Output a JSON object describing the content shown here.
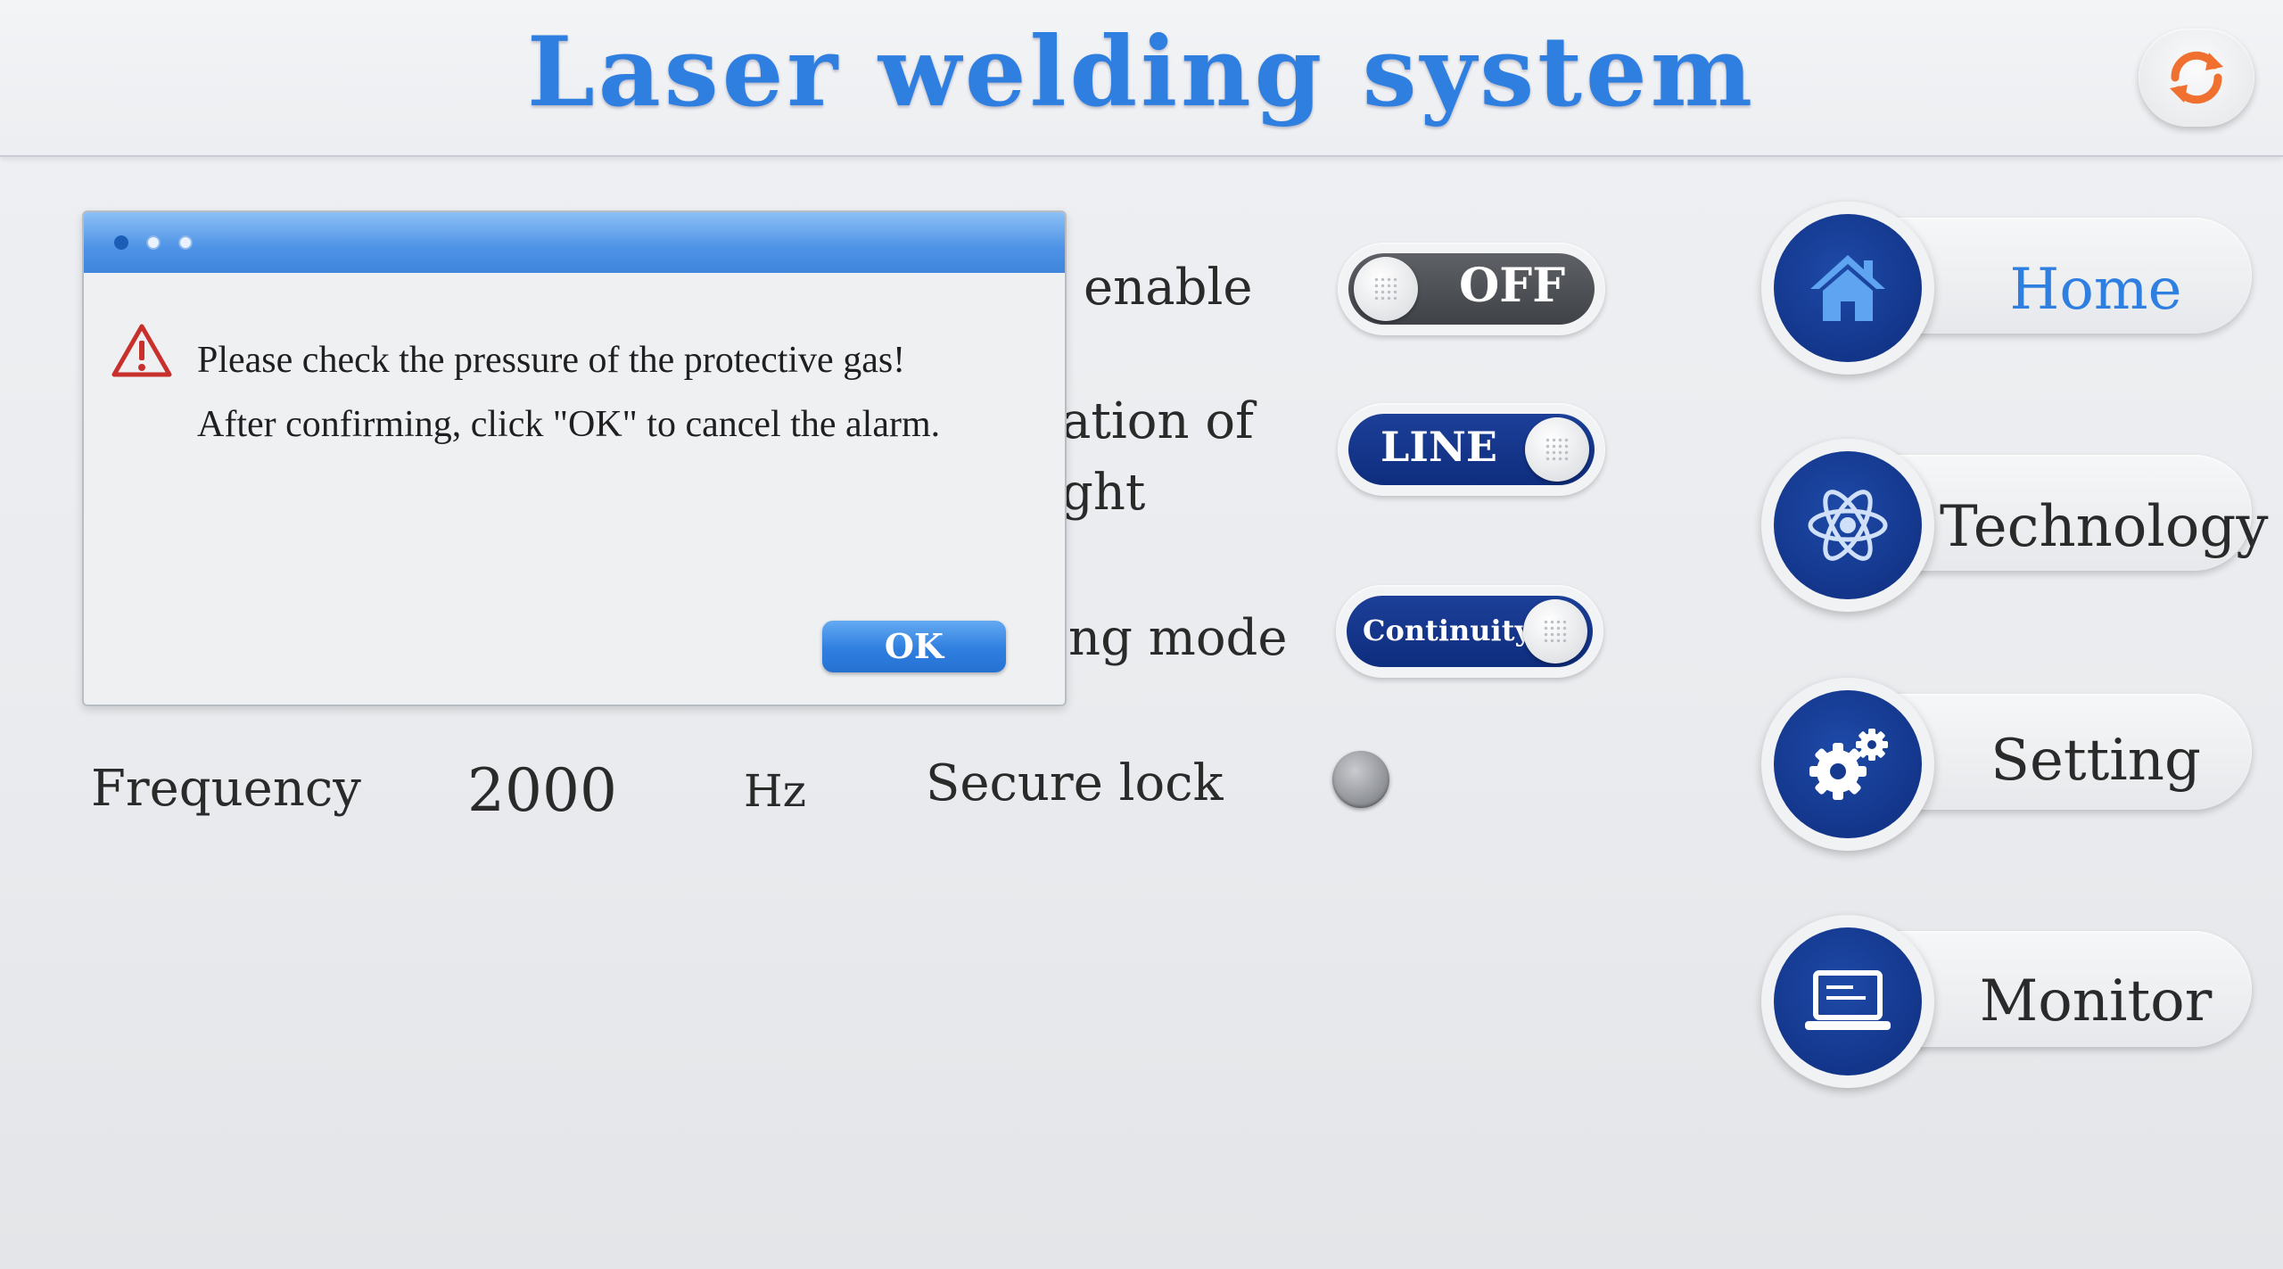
{
  "header": {
    "title": "Laser welding system",
    "refresh_icon": "refresh-icon"
  },
  "settings": {
    "row1": {
      "label": "enable",
      "toggle_text": "OFF",
      "toggle_state": "off"
    },
    "row2": {
      "label_line1": "ation of",
      "label_line2": "ght",
      "toggle_text": "LINE",
      "toggle_state": "on"
    },
    "row3": {
      "label": "ng mode",
      "toggle_text": "Continuity",
      "toggle_state": "on"
    },
    "frequency": {
      "label": "Frequency",
      "value": "2000",
      "unit": "Hz"
    },
    "secure_lock": {
      "label": "Secure lock",
      "state": "off"
    }
  },
  "nav": {
    "items": [
      {
        "label": "Home",
        "icon": "home-icon",
        "active": true
      },
      {
        "label": "Technology",
        "icon": "atom-icon",
        "active": false
      },
      {
        "label": "Setting",
        "icon": "gears-icon",
        "active": false
      },
      {
        "label": "Monitor",
        "icon": "laptop-icon",
        "active": false
      }
    ]
  },
  "alarm_dialog": {
    "message_line1": "Please check the pressure of the protective gas!",
    "message_line2": "After confirming, click \"OK\" to cancel the alarm.",
    "ok_label": "OK",
    "icon": "warning-icon"
  },
  "colors": {
    "title_blue": "#2f7fe0",
    "navy": "#0e2d7e",
    "active_nav_text": "#2f7fe0",
    "dialog_titlebar": "#4d92e6"
  }
}
